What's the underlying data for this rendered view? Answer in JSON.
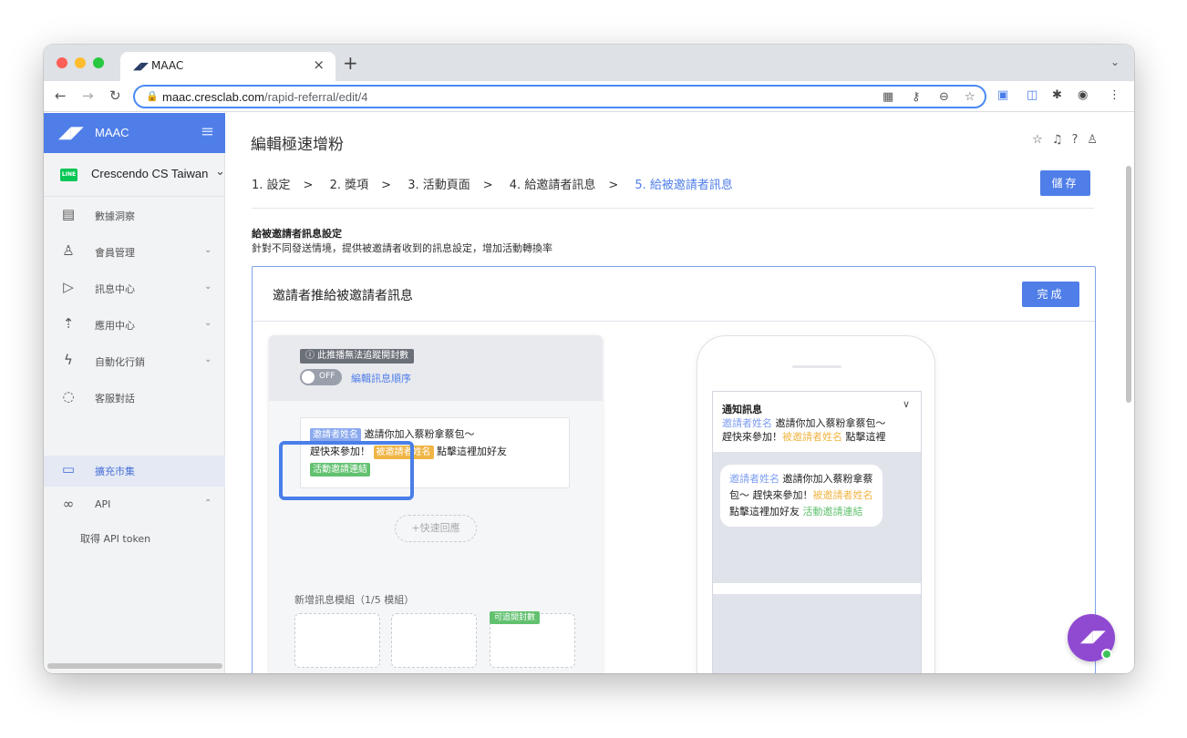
{
  "browser": {
    "tab_title": "MAAC",
    "tab_close": "×",
    "new_tab": "+",
    "url_host": "maac.cresclab.com",
    "url_path": "/rapid-referral/edit/4"
  },
  "sidebar": {
    "brand": "MAAC",
    "account": "Crescendo CS Taiwan",
    "line_badge": "LINE",
    "items": [
      {
        "label": "數據洞察"
      },
      {
        "label": "會員管理"
      },
      {
        "label": "訊息中心"
      },
      {
        "label": "應用中心"
      },
      {
        "label": "自動化行銷"
      },
      {
        "label": "客服對話"
      },
      {
        "label": "擴充市集"
      },
      {
        "label": "API"
      }
    ],
    "sub_item": "取得 API token"
  },
  "main": {
    "title": "編輯極速增粉",
    "steps": [
      "1. 設定",
      "2. 獎項",
      "3. 活動頁面",
      "4. 給邀請者訊息",
      "5. 給被邀請者訊息"
    ],
    "step_sep": ">",
    "save": "儲存",
    "section_title": "給被邀請者訊息設定",
    "section_desc": "針對不同發送情境，提供被邀請者收到的訊息設定，增加活動轉換率"
  },
  "panel": {
    "title": "邀請者推給被邀請者訊息",
    "done": "完成",
    "warning": "ⓘ 此推播無法追蹤開封數",
    "toggle": "OFF",
    "edit_order": "編輯訊息順序",
    "msg": {
      "tag_inviter": "邀請者姓名",
      "text1": "邀請你加入蔡粉拿蔡包～",
      "text2": "趕快來參加！",
      "tag_invitee": "被邀請者姓名",
      "text3": "點擊這裡加好友",
      "tag_link": "活動邀請連結"
    },
    "quick_reply": "+快速回應",
    "add_module": "新增訊息模組（1/5 模組）",
    "module_tag": "可追開封數"
  },
  "preview": {
    "notify_title": "通知訊息",
    "notify_inviter": "邀請者姓名",
    "notify_text1": " 邀請你加入蔡粉拿蔡包～",
    "notify_text2": "趕快來參加！",
    "notify_invitee": "被邀請者姓名",
    "notify_text3": " 點擊這裡",
    "bubble_inviter": "邀請者姓名",
    "bubble_text1": " 邀請你加入蔡粉拿蔡包～ 趕快來參加！",
    "bubble_invitee": "被邀請者姓名",
    "bubble_text2": " 點擊這裡加好友 ",
    "bubble_link": "活動邀請連結"
  },
  "colors": {
    "accent": "#4f7ee8",
    "tag_blue": "#8aa9ee",
    "tag_orange": "#f0b545",
    "tag_green": "#62c16f"
  }
}
